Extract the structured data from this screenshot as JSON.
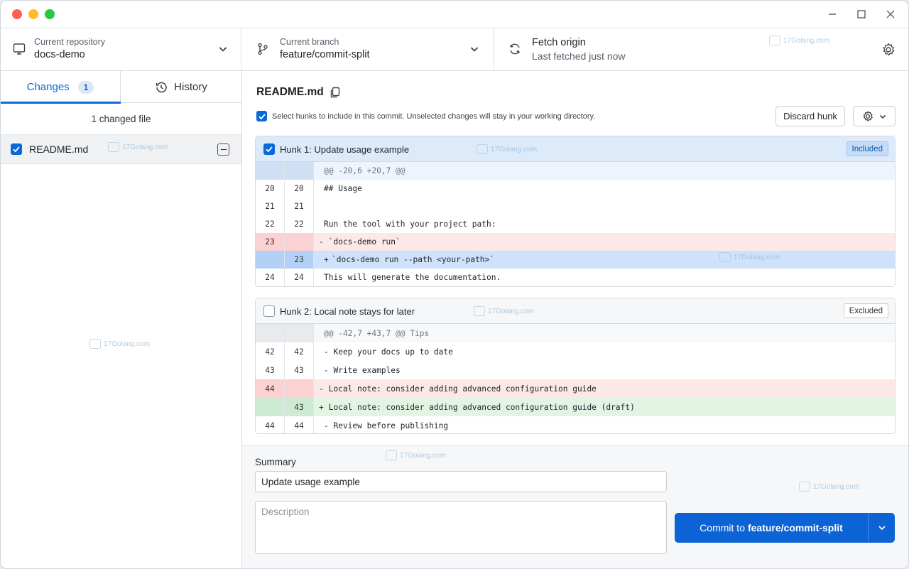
{
  "toolbar": {
    "repo_label": "Current repository",
    "repo_name": "docs-demo",
    "branch_label": "Current branch",
    "branch_name": "feature/commit-split",
    "fetch_title": "Fetch origin",
    "fetch_sub": "Last fetched just now"
  },
  "sidebar": {
    "tab_changes": "Changes",
    "tab_changes_count": "1",
    "tab_history": "History",
    "changed_count": "1 changed file",
    "files": [
      {
        "name": "README.md"
      }
    ]
  },
  "main": {
    "file_title": "README.md",
    "select_note": "Select hunks to include in this commit. Unselected changes will stay in your working directory.",
    "discard_label": "Discard hunk",
    "hunks": [
      {
        "title": "Hunk 1: Update usage example",
        "status": "Included",
        "header": "@@ -20,6 +20,7 @@",
        "lines": [
          {
            "old": "20",
            "new": "20",
            "sign": "",
            "text": "## Usage"
          },
          {
            "old": "21",
            "new": "21",
            "sign": "",
            "text": ""
          },
          {
            "old": "22",
            "new": "22",
            "sign": "",
            "text": "Run the tool with your project path:"
          },
          {
            "old": "23",
            "new": "",
            "sign": "-",
            "text": " `docs-demo run`"
          },
          {
            "old": "",
            "new": "23",
            "sign": "+",
            "text": "`docs-demo run --path <your-path>`"
          },
          {
            "old": "24",
            "new": "24",
            "sign": "",
            "text": "This will generate the documentation."
          }
        ]
      },
      {
        "title": "Hunk 2: Local note stays for later",
        "status": "Excluded",
        "header": "@@ -42,7 +43,7 @@ Tips",
        "lines": [
          {
            "old": "42",
            "new": "42",
            "sign": "",
            "text": "- Keep your docs up to date"
          },
          {
            "old": "43",
            "new": "43",
            "sign": "",
            "text": "- Write examples"
          },
          {
            "old": "44",
            "new": "",
            "sign": "-",
            "text": " Local note: consider adding advanced configuration guide"
          },
          {
            "old": "",
            "new": "43",
            "sign": "+",
            "text": " Local note: consider adding advanced configuration guide (draft)"
          },
          {
            "old": "44",
            "new": "44",
            "sign": "",
            "text": "- Review before publishing"
          }
        ]
      }
    ]
  },
  "commit": {
    "summary_label": "Summary",
    "summary_value": "Update usage example",
    "description_placeholder": "Description",
    "button_prefix": "Commit to",
    "button_branch": "feature/commit-split"
  },
  "watermark": "17Golang.com",
  "colors": {
    "accent": "#0969da",
    "commit_button": "#0b63d6"
  }
}
